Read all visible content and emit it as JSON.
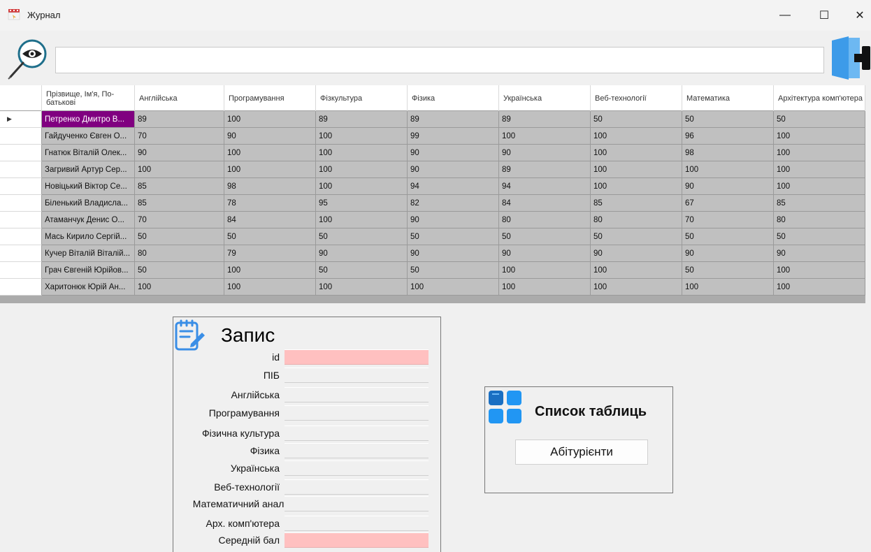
{
  "window": {
    "title": "Журнал",
    "minimize_glyph": "—",
    "maximize_glyph": "☐",
    "close_glyph": "✕"
  },
  "toolbar": {
    "search_value": "",
    "search_icon": "eye-magnifier-icon",
    "exit_icon": "door-exit-icon"
  },
  "grid": {
    "columns": [
      "Прізвище, Ім'я, По-батькові",
      "Англійська",
      "Програмування",
      "Фізкультура",
      "Фізика",
      "Українська",
      "Веб-технології",
      "Математика",
      "Архітектура комп'ютера"
    ],
    "current_row_marker": "▶",
    "rows": [
      [
        "Петренко Дмитро В...",
        "89",
        "100",
        "89",
        "89",
        "89",
        "50",
        "50",
        "50"
      ],
      [
        "Гайдученко Євген О...",
        "70",
        "90",
        "100",
        "99",
        "100",
        "100",
        "96",
        "100"
      ],
      [
        "Гнатюк Віталій Олек...",
        "90",
        "100",
        "100",
        "90",
        "90",
        "100",
        "98",
        "100"
      ],
      [
        "Загривий Артур Сер...",
        "100",
        "100",
        "100",
        "90",
        "89",
        "100",
        "100",
        "100"
      ],
      [
        "Новіцький Віктор Се...",
        "85",
        "98",
        "100",
        "94",
        "94",
        "100",
        "90",
        "100"
      ],
      [
        "Біленький Владисла...",
        "85",
        "78",
        "95",
        "82",
        "84",
        "85",
        "67",
        "85"
      ],
      [
        "Атаманчук Денис О...",
        "70",
        "84",
        "100",
        "90",
        "80",
        "80",
        "70",
        "80"
      ],
      [
        "Мась Кирило Сергій...",
        "50",
        "50",
        "50",
        "50",
        "50",
        "50",
        "50",
        "50"
      ],
      [
        "Кучер Віталій Віталій...",
        "80",
        "79",
        "90",
        "90",
        "90",
        "90",
        "90",
        "90"
      ],
      [
        "Грач Євгеній Юрійов...",
        "50",
        "100",
        "50",
        "50",
        "100",
        "100",
        "50",
        "100"
      ],
      [
        "Харитонюк Юрій Ан...",
        "100",
        "100",
        "100",
        "100",
        "100",
        "100",
        "100",
        "100"
      ]
    ],
    "selected_color": "#800080",
    "cell_color": "#c0c0c0"
  },
  "record": {
    "title": "Запис",
    "icon": "notepad-pen-icon",
    "fields": [
      {
        "label": "id",
        "value": "",
        "highlight": true
      },
      {
        "label": "ПІБ",
        "value": "",
        "highlight": false
      },
      {
        "label": "Англійська",
        "value": "",
        "highlight": false
      },
      {
        "label": "Програмування",
        "value": "",
        "highlight": false
      },
      {
        "label": "Фізична культура",
        "value": "",
        "highlight": false
      },
      {
        "label": "Фізика",
        "value": "",
        "highlight": false
      },
      {
        "label": "Українська",
        "value": "",
        "highlight": false
      },
      {
        "label": "Веб-технології",
        "value": "",
        "highlight": false
      },
      {
        "label": "Математичний аналіз",
        "value": "",
        "highlight": false
      },
      {
        "label": "Арх. комп'ютера",
        "value": "",
        "highlight": false
      },
      {
        "label": "Середній бал",
        "value": "",
        "highlight": true
      }
    ],
    "highlight_color": "#ffc0c0"
  },
  "tables": {
    "title": "Список таблиць",
    "icon": "grid-tiles-icon",
    "button_label": "Абітурієнти"
  }
}
